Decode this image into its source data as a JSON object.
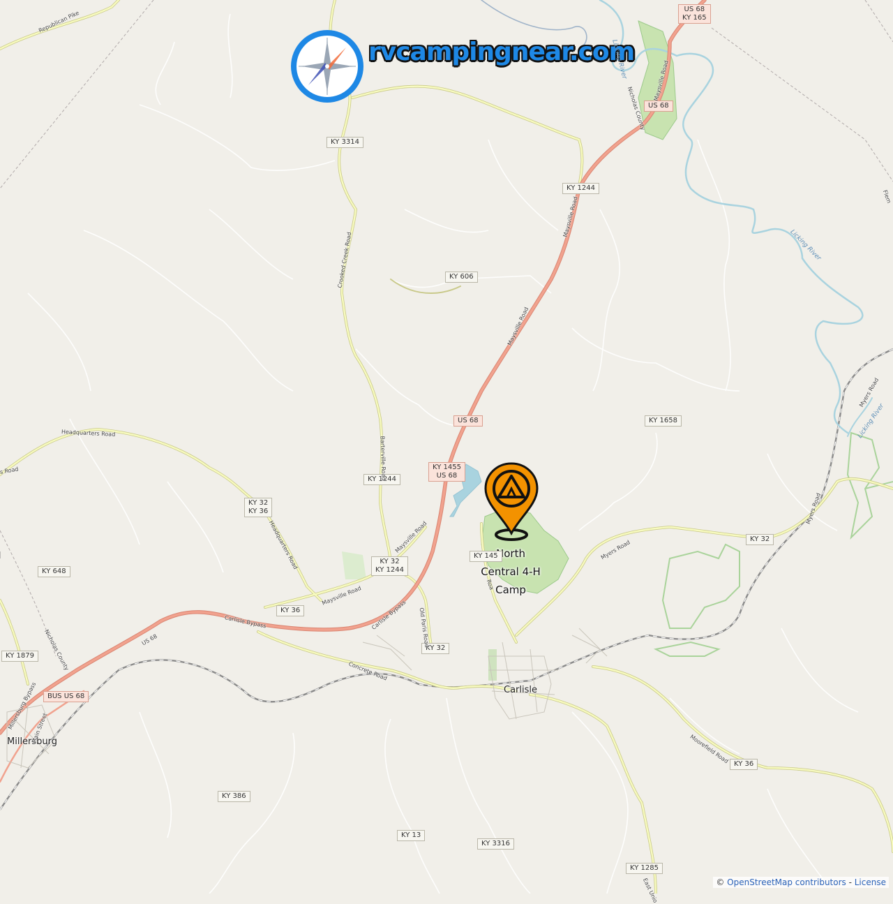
{
  "brand": {
    "name": "rvcampingnear.com",
    "logo_icon": "compass-icon"
  },
  "marker": {
    "name": "North Central 4-H Camp",
    "line1": "North",
    "line2": "Central 4-H",
    "line3": "Camp",
    "icon": "camping-tent-pin-icon",
    "color": "#f39200"
  },
  "places": {
    "carlisle": "Carlisle",
    "millersburg": "Millersburg"
  },
  "shields": {
    "us68_ky165": "US 68\nKY 165",
    "us68_north": "US 68",
    "ky3314": "KY 3314",
    "ky1244_north": "KY 1244",
    "ky606": "KY 606",
    "us68_mid": "US 68",
    "ky1455_us68": "KY 1455\nUS 68",
    "ky1244_mid": "KY 1244",
    "ky1658": "KY 1658",
    "ky32_ky36": "KY 32\nKY 36",
    "ky32_ky1244": "KY 32\nKY 1244",
    "ky145": "KY 145",
    "ky648": "KY 648",
    "ky36_west": "KY 36",
    "ky32_east": "KY 32",
    "ky32_south": "KY 32",
    "ky1879": "KY 1879",
    "bus_us68": "BUS US 68",
    "ky386": "KY 386",
    "ky13": "KY 13",
    "ky3316": "KY 3316",
    "ky36_east": "KY 36",
    "ky1285": "KY 1285"
  },
  "road_labels": {
    "republican_pike": "Republican Pike",
    "maysville_road_ne": "Maysville Road",
    "maysville_road_mid": "Maysville Road",
    "maysville_road_upper": "Maysville Road",
    "crooked_creek_road": "Crooked Creek Road",
    "headquarters_road": "Headquarters Road",
    "headquarters_road_2": "Headquarters Road",
    "barterville_road": "Barterville Road",
    "maysville_road_sw": "Maysville Road",
    "maysville_road_w": "Maysville Road",
    "carlisle_bypass": "Carlisle Bypass",
    "carlisle_bypass_2": "Carlisle Bypass",
    "us68_label": "US 68",
    "concrete_road": "Concrete Road",
    "old_paris_road": "Old Paris Road",
    "myers_road": "Myers Road",
    "myers_road_2": "Myers Road",
    "myers_road_ne": "Myers Road",
    "moorefield_road": "Moorefield Road",
    "millersburg_bypass": "Millersburg Bypass",
    "main_street": "Main Street",
    "nicholas_county": "Nicholas County",
    "nicholas_county_w": "Nicholas County",
    "east_union": "East Unio",
    "west_road": "s Road",
    "fleming": "Flem",
    "roa": "Roa"
  },
  "river_labels": {
    "licking_1": "Licking River",
    "licking_2": "Licking River",
    "licking_3": "Licking River"
  },
  "attribution": {
    "prefix": "©",
    "osm": "OpenStreetMap contributors",
    "sep": " - ",
    "license": "License"
  },
  "colors": {
    "background": "#f1efe9",
    "primary_road": "#e8937f",
    "secondary_road": "#dbe58a",
    "water": "#a9d3df",
    "park": "#b5dc9a",
    "railway": "#8a8a8a",
    "brand": "#1e88e5"
  }
}
